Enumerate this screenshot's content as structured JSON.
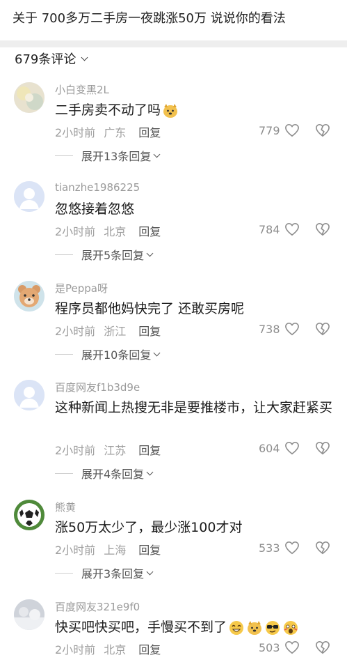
{
  "post": {
    "title": "关于 700多万二手房一夜跳涨50万 说说你的看法"
  },
  "comments_header": {
    "count_label": "679条评论"
  },
  "comments": [
    {
      "username": "小白变黑2L",
      "text": "二手房卖不动了吗",
      "time": "2小时前",
      "location": "广东",
      "reply_label": "回复",
      "likes": "779",
      "expand_label": "展开13条回复",
      "avatar": "blurred-photo",
      "emoji": [
        "dog-emoji"
      ]
    },
    {
      "username": "tianzhe1986225",
      "text": "忽悠接着忽悠",
      "time": "2小时前",
      "location": "北京",
      "reply_label": "回复",
      "likes": "784",
      "expand_label": "展开5条回复",
      "avatar": "default-user"
    },
    {
      "username": "是Peppa呀",
      "text": "程序员都他妈快完了 还敢买房呢",
      "time": "2小时前",
      "location": "浙江",
      "reply_label": "回复",
      "likes": "738",
      "expand_label": "展开10条回复",
      "avatar": "bear"
    },
    {
      "username": "百度网友f1b3d9e",
      "text": "这种新闻上热搜无非是要推楼市，让大家赶紧买",
      "time": "2小时前",
      "location": "江苏",
      "reply_label": "回复",
      "likes": "604",
      "expand_label": "展开4条回复",
      "avatar": "default-user"
    },
    {
      "username": "熊黄",
      "text": "涨50万太少了，最少涨100才对",
      "time": "2小时前",
      "location": "上海",
      "reply_label": "回复",
      "likes": "533",
      "expand_label": "展开3条回复",
      "avatar": "soccer-ball"
    },
    {
      "username": "百度网友321e9f0",
      "text": "快买吧快买吧，手慢买不到了",
      "time": "2小时前",
      "location": "北京",
      "reply_label": "回复",
      "likes": "503",
      "avatar": "snowy-photo",
      "emoji": [
        "grin-emoji",
        "dog-emoji",
        "sunglasses-emoji",
        "scared-emoji"
      ]
    }
  ],
  "colors": {
    "meta_gray": "#9e9e9e",
    "divider_band": "#eeeeee",
    "text": "#1b1b1b"
  }
}
